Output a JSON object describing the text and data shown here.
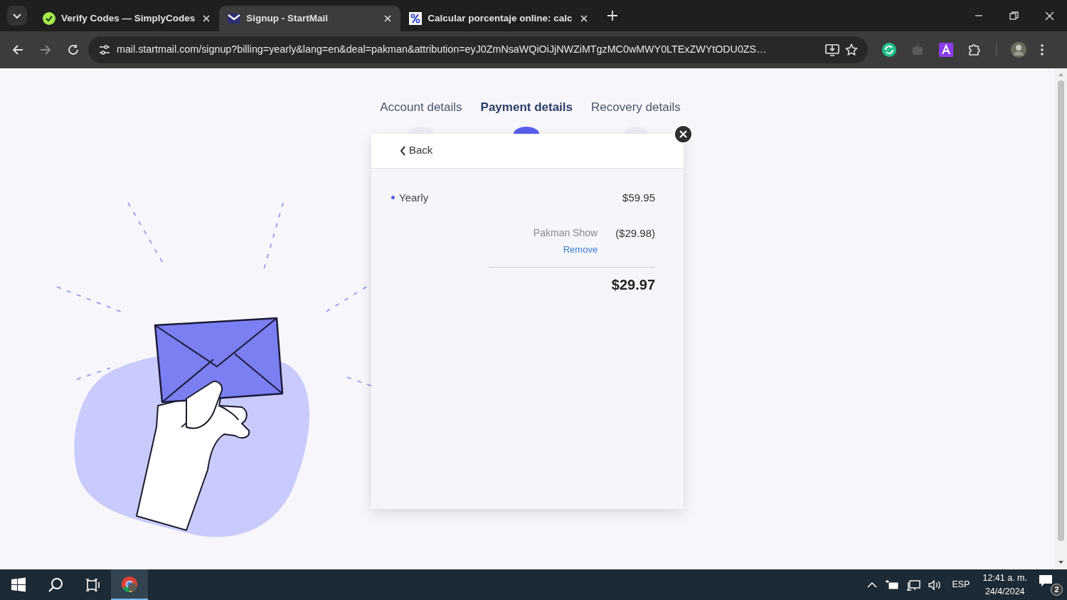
{
  "browser": {
    "tabs": [
      {
        "title": "Verify Codes — SimplyCodes",
        "selected": false
      },
      {
        "title": "Signup - StartMail",
        "selected": true
      },
      {
        "title": "Calcular porcentaje online: calc",
        "selected": false
      }
    ],
    "address": "mail.startmail.com/signup?billing=yearly&lang=en&deal=pakman&attribution=eyJ0ZmNsaWQiOiJjNWZiMTgzMC0wMWY0LTExZWYtODU0ZS…"
  },
  "steps": [
    {
      "label": "Account details",
      "selected": false
    },
    {
      "label": "Payment details",
      "selected": true
    },
    {
      "label": "Recovery details",
      "selected": false
    }
  ],
  "card": {
    "back": "Back",
    "plan": {
      "name": "Yearly",
      "price": "$59.95"
    },
    "discount": {
      "name": "Pakman Show",
      "amount": "($29.98)",
      "action": "Remove"
    },
    "total": "$29.97"
  },
  "taskbar": {
    "language": "ESP",
    "time": "12:41 a. m.",
    "date": "24/4/2024",
    "notifications": "2"
  }
}
